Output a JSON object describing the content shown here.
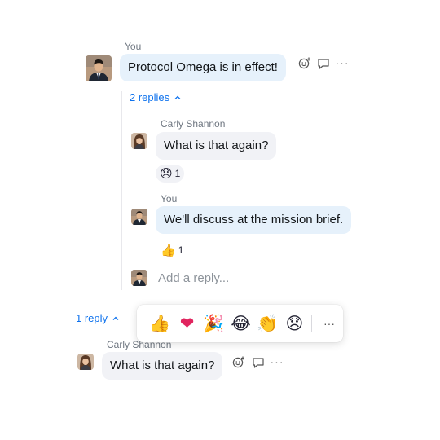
{
  "message1": {
    "sender": "You",
    "text": "Protocol Omega is in effect!",
    "replies_link": "2 replies"
  },
  "thread": {
    "replies": [
      {
        "sender": "Carly Shannon",
        "text": "What is that again?",
        "reaction": {
          "icon": "disappointed-face",
          "emoji": "😞",
          "count": "1"
        }
      },
      {
        "sender": "You",
        "text": "We'll discuss at the mission brief.",
        "reaction": {
          "icon": "thumbs-up",
          "emoji": "👍",
          "count": "1"
        }
      }
    ],
    "reply_placeholder": "Add a reply..."
  },
  "message2": {
    "replies_link": "1 reply",
    "sender": "Carly Shannon",
    "text": "What is that again?"
  },
  "emoji_picker": {
    "emojis": [
      {
        "name": "thumbs-up",
        "glyph": "👍"
      },
      {
        "name": "red-heart",
        "glyph": "❤"
      },
      {
        "name": "party-popper",
        "glyph": "🎉"
      },
      {
        "name": "face-with-tears-of-joy",
        "glyph": "😂"
      },
      {
        "name": "clapping-hands",
        "glyph": "👏"
      },
      {
        "name": "disappointed-face",
        "glyph": "😞"
      }
    ],
    "more": "···"
  },
  "actions": {
    "more": "···"
  },
  "colors": {
    "accent": "#0e72ed",
    "my_bubble": "#e6f1fb",
    "other_bubble": "#f1f2f6"
  }
}
